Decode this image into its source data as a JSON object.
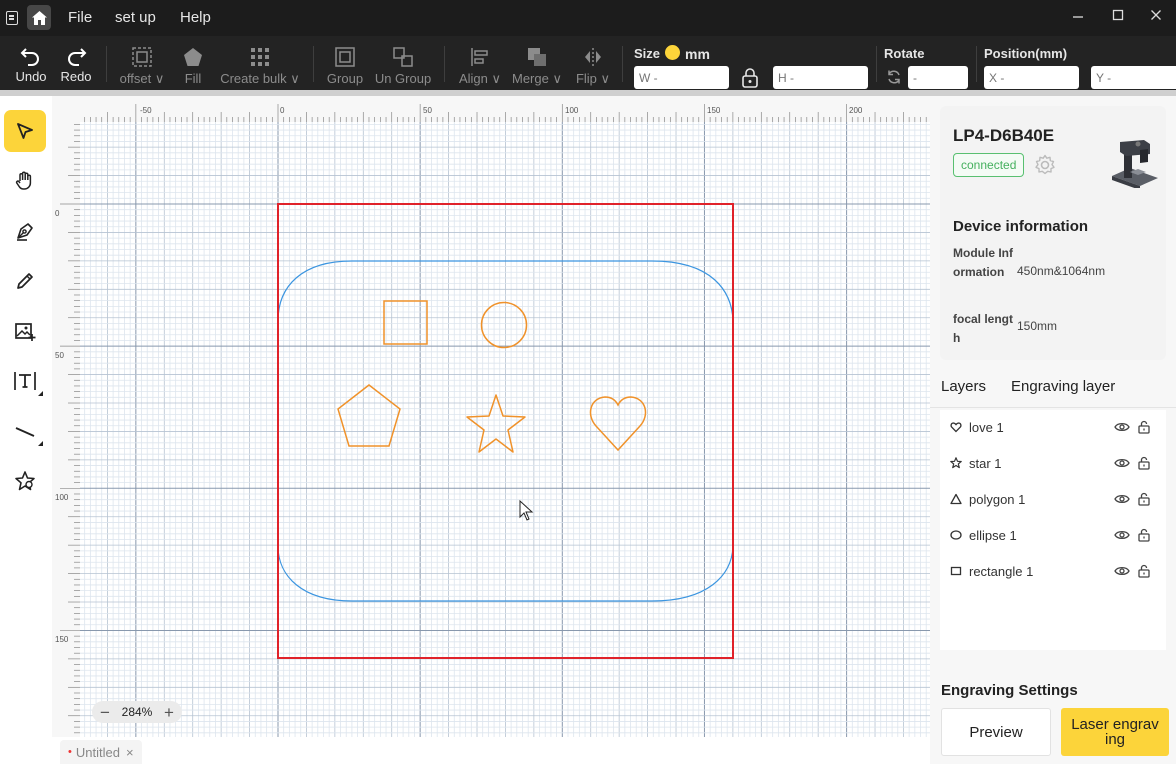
{
  "menu": {
    "file": "File",
    "setup": "set up",
    "help": "Help"
  },
  "toolbar": {
    "undo": "Undo",
    "redo": "Redo",
    "offset": "offset",
    "fill": "Fill",
    "create_bulk": "Create bulk",
    "group": "Group",
    "ungroup": "Un Group",
    "align": "Align",
    "merge": "Merge",
    "flip": "Flip",
    "size_label": "Size",
    "size_unit": "mm",
    "w_placeholder": "W -",
    "h_placeholder": "H -",
    "rotate_label": "Rotate",
    "rotate_placeholder": "-",
    "position_label": "Position(mm)",
    "x_placeholder": "X -",
    "y_placeholder": "Y -"
  },
  "rulers": {
    "top": [
      "-50",
      "0",
      "50",
      "100",
      "150",
      "200"
    ],
    "left": [
      "0",
      "50",
      "100",
      "150"
    ]
  },
  "zoom": {
    "level": "284%",
    "minus": "−",
    "plus": "+"
  },
  "document": {
    "tab": "Untitled",
    "close": "×",
    "modified_marker": "•"
  },
  "device": {
    "name": "LP4-D6B40E",
    "status": "connected",
    "info_title": "Device information",
    "module_key": "Module Information",
    "module_value": "450nm&1064nm",
    "focal_key": "focal length",
    "focal_value": "150mm"
  },
  "tabs": {
    "layers": "Layers",
    "engraving_layer": "Engraving layer"
  },
  "layers": [
    {
      "name": "love 1",
      "icon": "heart-icon"
    },
    {
      "name": "star 1",
      "icon": "star-icon"
    },
    {
      "name": "polygon 1",
      "icon": "triangle-icon"
    },
    {
      "name": "ellipse 1",
      "icon": "ellipse-icon"
    },
    {
      "name": "rectangle 1",
      "icon": "rectangle-icon"
    }
  ],
  "engraving": {
    "title": "Engraving Settings",
    "preview": "Preview",
    "laser": "Laser engraving"
  },
  "colors": {
    "accent": "#fcd43a",
    "selection": "#e0222a",
    "shape": "#f0922a",
    "boundary": "#3b95e0",
    "connected": "#45b05e"
  }
}
